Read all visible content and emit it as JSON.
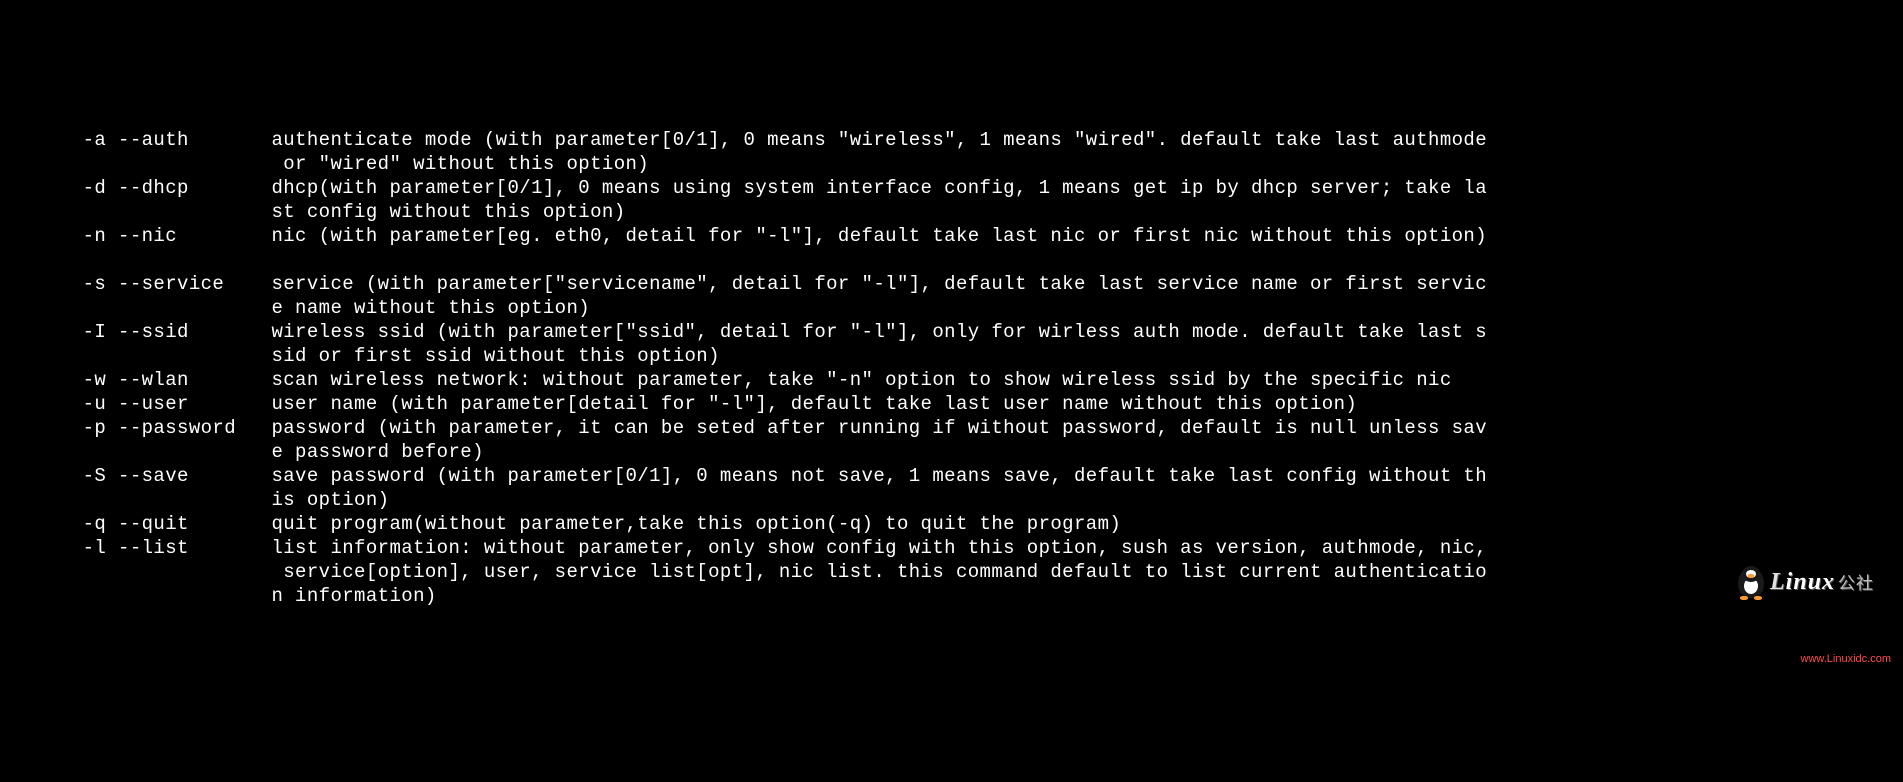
{
  "terminal": {
    "lines": [
      "       -a --auth       authenticate mode (with parameter[0/1], 0 means \"wireless\", 1 means \"wired\". default take last authmode",
      "                        or \"wired\" without this option)",
      "       -d --dhcp       dhcp(with parameter[0/1], 0 means using system interface config, 1 means get ip by dhcp server; take la",
      "                       st config without this option)",
      "       -n --nic        nic (with parameter[eg. eth0, detail for \"-l\"], default take last nic or first nic without this option)",
      "",
      "       -s --service    service (with parameter[\"servicename\", detail for \"-l\"], default take last service name or first servic",
      "                       e name without this option)",
      "       -I --ssid       wireless ssid (with parameter[\"ssid\", detail for \"-l\"], only for wirless auth mode. default take last s",
      "                       sid or first ssid without this option)",
      "       -w --wlan       scan wireless network: without parameter, take \"-n\" option to show wireless ssid by the specific nic",
      "       -u --user       user name (with parameter[detail for \"-l\"], default take last user name without this option)",
      "       -p --password   password (with parameter, it can be seted after running if without password, default is null unless sav",
      "                       e password before)",
      "       -S --save       save password (with parameter[0/1], 0 means not save, 1 means save, default take last config without th",
      "                       is option)",
      "       -q --quit       quit program(without parameter,take this option(-q) to quit the program)",
      "       -l --list       list information: without parameter, only show config with this option, sush as version, authmode, nic,",
      "                        service[option], user, service list[opt], nic list. this command default to list current authenticatio",
      "                       n information)"
    ]
  },
  "logo": {
    "brand_text": "inux",
    "brand_leading": "L",
    "brand_cn": "公社",
    "url": "www.Linuxidc.com"
  }
}
